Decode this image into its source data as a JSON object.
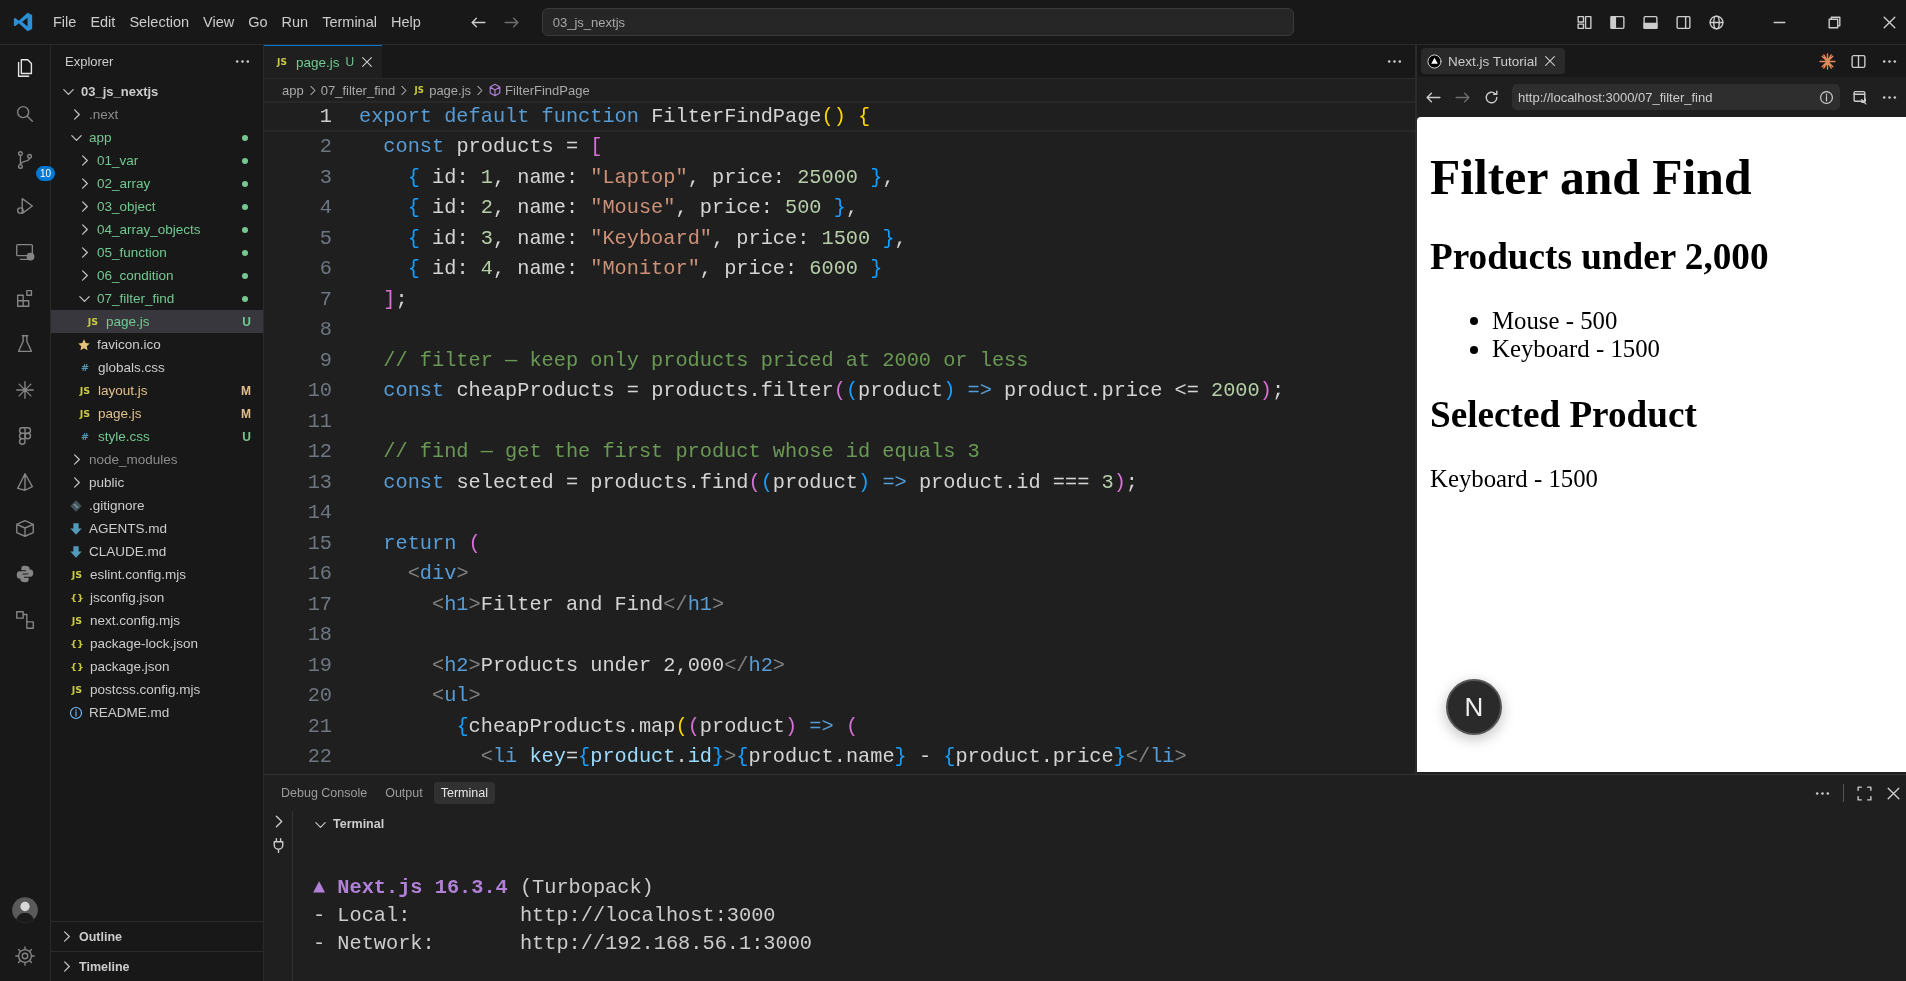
{
  "title_bar": {
    "menu": [
      "File",
      "Edit",
      "Selection",
      "View",
      "Go",
      "Run",
      "Terminal",
      "Help"
    ],
    "command_center": "03_js_nextjs"
  },
  "activity_bar": {
    "items": [
      {
        "kind": "explorer",
        "selected": true
      },
      {
        "kind": "search",
        "selected": false
      },
      {
        "kind": "source-control",
        "selected": false,
        "badge": "10"
      },
      {
        "kind": "run-debug",
        "selected": false
      },
      {
        "kind": "remote-explorer",
        "selected": false
      },
      {
        "kind": "extensions",
        "selected": false
      },
      {
        "kind": "testing",
        "selected": false
      },
      {
        "kind": "spark",
        "selected": false
      },
      {
        "kind": "figma",
        "selected": false
      },
      {
        "kind": "prism",
        "selected": false
      },
      {
        "kind": "containers",
        "selected": false
      },
      {
        "kind": "python",
        "selected": false
      },
      {
        "kind": "graph",
        "selected": false
      }
    ],
    "bottom": [
      {
        "kind": "account"
      },
      {
        "kind": "settings"
      }
    ]
  },
  "sidebar": {
    "title": "Explorer",
    "tree": [
      {
        "label": "03_js_nextjs",
        "kind": "root",
        "expanded": true,
        "selected": false,
        "children": [
          {
            "label": ".next",
            "kind": "folder",
            "expanded": false,
            "color": "#8c8c8c",
            "selected": false
          },
          {
            "label": "app",
            "kind": "folder",
            "expanded": true,
            "color": "#73c991",
            "changed": true,
            "selected": false,
            "children": [
              {
                "label": "01_var",
                "kind": "folder",
                "expanded": false,
                "color": "#73c991",
                "changed": true,
                "selected": false
              },
              {
                "label": "02_array",
                "kind": "folder",
                "expanded": false,
                "color": "#73c991",
                "changed": true,
                "selected": false
              },
              {
                "label": "03_object",
                "kind": "folder",
                "expanded": false,
                "color": "#73c991",
                "changed": true,
                "selected": false
              },
              {
                "label": "04_array_objects",
                "kind": "folder",
                "expanded": false,
                "color": "#73c991",
                "changed": true,
                "selected": false
              },
              {
                "label": "05_function",
                "kind": "folder",
                "expanded": false,
                "color": "#73c991",
                "changed": true,
                "selected": false
              },
              {
                "label": "06_condition",
                "kind": "folder",
                "expanded": false,
                "color": "#73c991",
                "changed": true,
                "selected": false
              },
              {
                "label": "07_filter_find",
                "kind": "folder",
                "expanded": true,
                "color": "#73c991",
                "changed": true,
                "selected": false,
                "children": [
                  {
                    "label": "page.js",
                    "kind": "js",
                    "glyph": "JS",
                    "color": "#73c991",
                    "status": "U",
                    "selected": true
                  }
                ]
              },
              {
                "label": "favicon.ico",
                "kind": "image",
                "selected": false
              },
              {
                "label": "globals.css",
                "kind": "css",
                "glyph": "#",
                "selected": false
              },
              {
                "label": "layout.js",
                "kind": "js",
                "glyph": "JS",
                "color": "#e2c08d",
                "status": "M",
                "selected": false
              },
              {
                "label": "page.js",
                "kind": "js",
                "glyph": "JS",
                "color": "#e2c08d",
                "status": "M",
                "selected": false
              },
              {
                "label": "style.css",
                "kind": "css",
                "glyph": "#",
                "color": "#73c991",
                "status": "U",
                "selected": false
              }
            ]
          },
          {
            "label": "node_modules",
            "kind": "folder",
            "expanded": false,
            "color": "#8c8c8c",
            "selected": false
          },
          {
            "label": "public",
            "kind": "folder",
            "expanded": false,
            "selected": false
          },
          {
            "label": ".gitignore",
            "kind": "git",
            "selected": false
          },
          {
            "label": "AGENTS.md",
            "kind": "markdown",
            "selected": false
          },
          {
            "label": "CLAUDE.md",
            "kind": "markdown",
            "selected": false
          },
          {
            "label": "eslint.config.mjs",
            "kind": "js",
            "glyph": "JS",
            "selected": false
          },
          {
            "label": "jsconfig.json",
            "kind": "json",
            "glyph": "{}",
            "selected": false
          },
          {
            "label": "next.config.mjs",
            "kind": "js",
            "glyph": "JS",
            "selected": false
          },
          {
            "label": "package-lock.json",
            "kind": "json",
            "glyph": "{}",
            "selected": false
          },
          {
            "label": "package.json",
            "kind": "json",
            "glyph": "{}",
            "selected": false
          },
          {
            "label": "postcss.config.mjs",
            "kind": "js",
            "glyph": "JS",
            "selected": false
          },
          {
            "label": "README.md",
            "kind": "info",
            "selected": false
          }
        ]
      }
    ],
    "sections": [
      {
        "label": "Outline",
        "expanded": false
      },
      {
        "label": "Timeline",
        "expanded": false
      }
    ]
  },
  "editor": {
    "tabs": [
      {
        "label": "page.js",
        "glyph": "JS",
        "color": "#73c991",
        "status": "U",
        "selected": true
      }
    ],
    "breadcrumbs": [
      {
        "label": "app",
        "kind": "folder"
      },
      {
        "label": "07_filter_find",
        "kind": "folder"
      },
      {
        "label": "page.js",
        "kind": "js",
        "glyph": "JS"
      },
      {
        "label": "FilterFindPage",
        "kind": "symbol"
      }
    ],
    "lines": [
      {
        "number": "1",
        "current": true,
        "text": "export default function FilterFindPage() {"
      },
      {
        "number": "2",
        "current": false,
        "text": "  const products = ["
      },
      {
        "number": "3",
        "current": false,
        "text": "    { id: 1, name: \"Laptop\", price: 25000 },"
      },
      {
        "number": "4",
        "current": false,
        "text": "    { id: 2, name: \"Mouse\", price: 500 },"
      },
      {
        "number": "5",
        "current": false,
        "text": "    { id: 3, name: \"Keyboard\", price: 1500 },"
      },
      {
        "number": "6",
        "current": false,
        "text": "    { id: 4, name: \"Monitor\", price: 6000 }"
      },
      {
        "number": "7",
        "current": false,
        "text": "  ];"
      },
      {
        "number": "8",
        "current": false
      },
      {
        "number": "9",
        "current": false,
        "text": "  // filter — keep only products priced at 2000 or less"
      },
      {
        "number": "10",
        "current": false,
        "text": "  const cheapProducts = products.filter((product) => product.price <= 2000);"
      },
      {
        "number": "11",
        "current": false
      },
      {
        "number": "12",
        "current": false,
        "text": "  // find — get the first product whose id equals 3"
      },
      {
        "number": "13",
        "current": false,
        "text": "  const selected = products.find((product) => product.id === 3);"
      },
      {
        "number": "14",
        "current": false
      },
      {
        "number": "15",
        "current": false,
        "text": "  return ("
      },
      {
        "number": "16",
        "current": false,
        "text": "    <div>"
      },
      {
        "number": "17",
        "current": false,
        "text": "      <h1>Filter and Find</h1>"
      },
      {
        "number": "18",
        "current": false
      },
      {
        "number": "19",
        "current": false,
        "text": "      <h2>Products under 2,000</h2>"
      },
      {
        "number": "20",
        "current": false,
        "text": "      <ul>"
      },
      {
        "number": "21",
        "current": false,
        "text": "        {cheapProducts.map((product) => ("
      },
      {
        "number": "22",
        "current": false,
        "text": "          <li key={product.id}>{product.name} - {product.price}</li>"
      }
    ]
  },
  "browser": {
    "tab": {
      "title": "Next.js Tutorial"
    },
    "url": "http://localhost:3000/07_filter_find",
    "page": {
      "blocks": [
        {
          "kind": "h1",
          "text": "Filter and Find"
        },
        {
          "kind": "h2",
          "text": "Products under 2,000"
        },
        {
          "kind": "list",
          "items": [
            "Mouse - 500",
            "Keyboard - 1500"
          ]
        },
        {
          "kind": "h2",
          "text": "Selected Product"
        },
        {
          "kind": "p",
          "text": "Keyboard - 1500"
        }
      ],
      "dev_badge": "N"
    }
  },
  "panel": {
    "tabs": [
      {
        "label": "Debug Console",
        "selected": false
      },
      {
        "label": "Output",
        "selected": false
      },
      {
        "label": "Terminal",
        "selected": true
      }
    ],
    "terminal": {
      "title": "Terminal",
      "expanded": true,
      "lines": [
        [
          {
            "kind": "accent",
            "text": "▲ Next.js 16.3.4"
          },
          {
            "kind": "plain",
            "text": " (Turbopack)"
          }
        ],
        [
          {
            "kind": "plain",
            "text": "- Local:         http://localhost:3000"
          }
        ],
        [
          {
            "kind": "plain",
            "text": "- Network:       http://192.168.56.1:3000"
          }
        ]
      ]
    }
  }
}
